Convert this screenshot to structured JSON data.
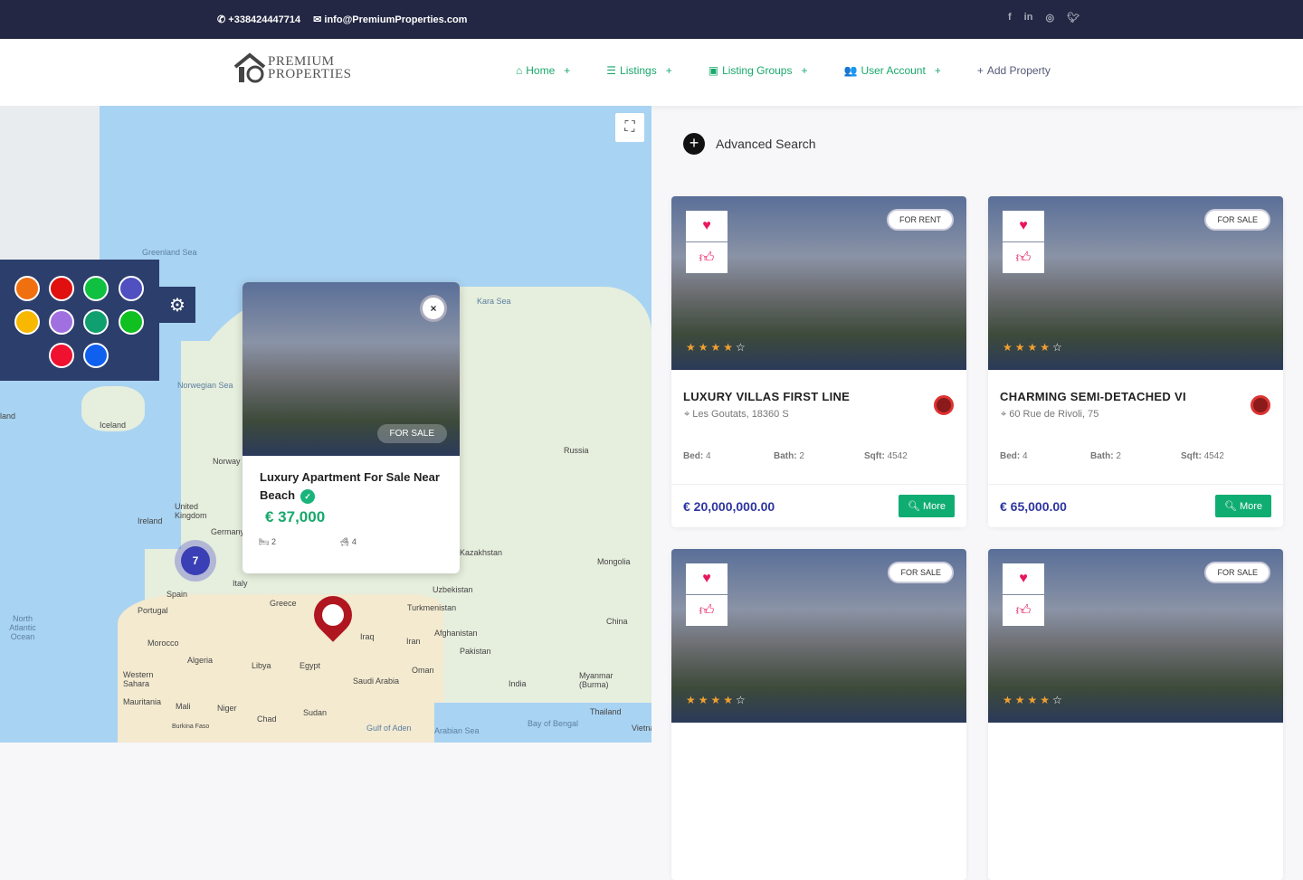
{
  "topbar": {
    "phone": "+338424447714",
    "email": "info@PremiumProperties.com",
    "social": [
      "facebook",
      "linkedin",
      "instagram",
      "twitter"
    ]
  },
  "logo": {
    "line1": "PREMIUM",
    "line2": "PROPERTIES"
  },
  "nav": {
    "items": [
      {
        "label": "Home",
        "icon": "⌂"
      },
      {
        "label": "Listings",
        "icon": "☰"
      },
      {
        "label": "Listing Groups",
        "icon": "▣"
      },
      {
        "label": "User Account",
        "icon": "👥"
      }
    ],
    "add_property": "Add Property"
  },
  "map": {
    "labels": [
      "Greenland Sea",
      "Kara Sea",
      "Norwegian Sea",
      "Iceland",
      "Norway",
      "Russia",
      "United Kingdom",
      "Ireland",
      "Germany",
      "Spain",
      "Portugal",
      "Italy",
      "Greece",
      "Kazakhstan",
      "Mongolia",
      "Uzbekistan",
      "Turkmenistan",
      "Afghanistan",
      "Pakistan",
      "Iraq",
      "Iran",
      "China",
      "Morocco",
      "Algeria",
      "Libya",
      "Egypt",
      "Saudi Arabia",
      "India",
      "Western Sahara",
      "Mauritania",
      "Mali",
      "Niger",
      "Chad",
      "Sudan",
      "Oman",
      "Myanmar (Burma)",
      "Thailand",
      "Bay of Bengal",
      "Arabian Sea",
      "Gulf of Aden",
      "North Atlantic Ocean",
      "Burkina Faso",
      "Vietnam",
      "land"
    ],
    "cluster_count": "7",
    "palette": [
      "#f07010",
      "#e01010",
      "#10c040",
      "#5050c0",
      "#f8b800",
      "#a070e0",
      "#10a070",
      "#10c020",
      "#f01030",
      "#1060f0"
    ],
    "popup": {
      "badge": "FOR SALE",
      "title": "Luxury Apartment For Sale Near Beach",
      "price": "€ 37,000",
      "beds": "2",
      "baths": "4",
      "close": "×"
    }
  },
  "search": {
    "label": "Advanced Search"
  },
  "listings": [
    {
      "tag": "FOR RENT",
      "rating": 4,
      "title": "LUXURY VILLAS FIRST LINE",
      "address": "Les Goutats, 18360 S",
      "bed": "4",
      "bath": "2",
      "sqft": "4542",
      "price": "€ 20,000,000.00",
      "more": "More"
    },
    {
      "tag": "FOR SALE",
      "rating": 4,
      "title": "CHARMING SEMI-DETACHED VI",
      "address": "60 Rue de Rivoli, 75",
      "bed": "4",
      "bath": "2",
      "sqft": "4542",
      "price": "€ 65,000.00",
      "more": "More"
    },
    {
      "tag": "FOR SALE",
      "rating": 4
    },
    {
      "tag": "FOR SALE",
      "rating": 4
    }
  ],
  "labels": {
    "bed": "Bed:",
    "bath": "Bath:",
    "sqft": "Sqft:"
  }
}
